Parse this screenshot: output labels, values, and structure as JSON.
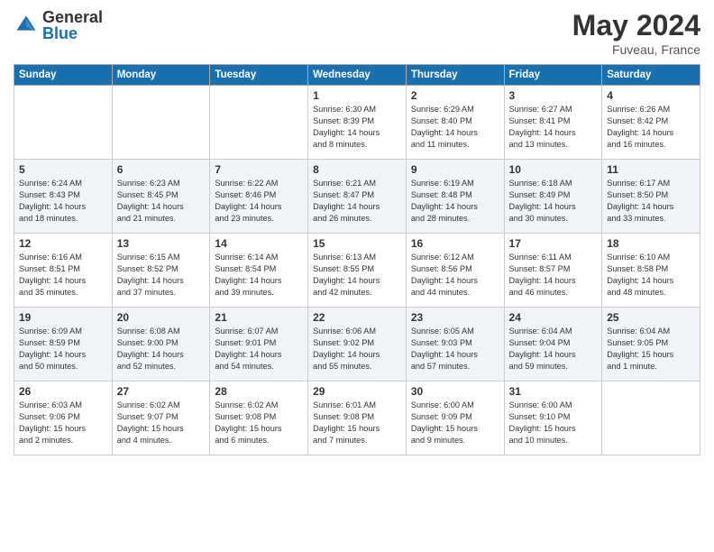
{
  "header": {
    "logo_general": "General",
    "logo_blue": "Blue",
    "month_title": "May 2024",
    "location": "Fuveau, France"
  },
  "days_of_week": [
    "Sunday",
    "Monday",
    "Tuesday",
    "Wednesday",
    "Thursday",
    "Friday",
    "Saturday"
  ],
  "weeks": [
    {
      "cells": [
        {
          "day": "",
          "content": ""
        },
        {
          "day": "",
          "content": ""
        },
        {
          "day": "",
          "content": ""
        },
        {
          "day": "1",
          "content": "Sunrise: 6:30 AM\nSunset: 8:39 PM\nDaylight: 14 hours\nand 8 minutes."
        },
        {
          "day": "2",
          "content": "Sunrise: 6:29 AM\nSunset: 8:40 PM\nDaylight: 14 hours\nand 11 minutes."
        },
        {
          "day": "3",
          "content": "Sunrise: 6:27 AM\nSunset: 8:41 PM\nDaylight: 14 hours\nand 13 minutes."
        },
        {
          "day": "4",
          "content": "Sunrise: 6:26 AM\nSunset: 8:42 PM\nDaylight: 14 hours\nand 16 minutes."
        }
      ]
    },
    {
      "cells": [
        {
          "day": "5",
          "content": "Sunrise: 6:24 AM\nSunset: 8:43 PM\nDaylight: 14 hours\nand 18 minutes."
        },
        {
          "day": "6",
          "content": "Sunrise: 6:23 AM\nSunset: 8:45 PM\nDaylight: 14 hours\nand 21 minutes."
        },
        {
          "day": "7",
          "content": "Sunrise: 6:22 AM\nSunset: 8:46 PM\nDaylight: 14 hours\nand 23 minutes."
        },
        {
          "day": "8",
          "content": "Sunrise: 6:21 AM\nSunset: 8:47 PM\nDaylight: 14 hours\nand 26 minutes."
        },
        {
          "day": "9",
          "content": "Sunrise: 6:19 AM\nSunset: 8:48 PM\nDaylight: 14 hours\nand 28 minutes."
        },
        {
          "day": "10",
          "content": "Sunrise: 6:18 AM\nSunset: 8:49 PM\nDaylight: 14 hours\nand 30 minutes."
        },
        {
          "day": "11",
          "content": "Sunrise: 6:17 AM\nSunset: 8:50 PM\nDaylight: 14 hours\nand 33 minutes."
        }
      ]
    },
    {
      "cells": [
        {
          "day": "12",
          "content": "Sunrise: 6:16 AM\nSunset: 8:51 PM\nDaylight: 14 hours\nand 35 minutes."
        },
        {
          "day": "13",
          "content": "Sunrise: 6:15 AM\nSunset: 8:52 PM\nDaylight: 14 hours\nand 37 minutes."
        },
        {
          "day": "14",
          "content": "Sunrise: 6:14 AM\nSunset: 8:54 PM\nDaylight: 14 hours\nand 39 minutes."
        },
        {
          "day": "15",
          "content": "Sunrise: 6:13 AM\nSunset: 8:55 PM\nDaylight: 14 hours\nand 42 minutes."
        },
        {
          "day": "16",
          "content": "Sunrise: 6:12 AM\nSunset: 8:56 PM\nDaylight: 14 hours\nand 44 minutes."
        },
        {
          "day": "17",
          "content": "Sunrise: 6:11 AM\nSunset: 8:57 PM\nDaylight: 14 hours\nand 46 minutes."
        },
        {
          "day": "18",
          "content": "Sunrise: 6:10 AM\nSunset: 8:58 PM\nDaylight: 14 hours\nand 48 minutes."
        }
      ]
    },
    {
      "cells": [
        {
          "day": "19",
          "content": "Sunrise: 6:09 AM\nSunset: 8:59 PM\nDaylight: 14 hours\nand 50 minutes."
        },
        {
          "day": "20",
          "content": "Sunrise: 6:08 AM\nSunset: 9:00 PM\nDaylight: 14 hours\nand 52 minutes."
        },
        {
          "day": "21",
          "content": "Sunrise: 6:07 AM\nSunset: 9:01 PM\nDaylight: 14 hours\nand 54 minutes."
        },
        {
          "day": "22",
          "content": "Sunrise: 6:06 AM\nSunset: 9:02 PM\nDaylight: 14 hours\nand 55 minutes."
        },
        {
          "day": "23",
          "content": "Sunrise: 6:05 AM\nSunset: 9:03 PM\nDaylight: 14 hours\nand 57 minutes."
        },
        {
          "day": "24",
          "content": "Sunrise: 6:04 AM\nSunset: 9:04 PM\nDaylight: 14 hours\nand 59 minutes."
        },
        {
          "day": "25",
          "content": "Sunrise: 6:04 AM\nSunset: 9:05 PM\nDaylight: 15 hours\nand 1 minute."
        }
      ]
    },
    {
      "cells": [
        {
          "day": "26",
          "content": "Sunrise: 6:03 AM\nSunset: 9:06 PM\nDaylight: 15 hours\nand 2 minutes."
        },
        {
          "day": "27",
          "content": "Sunrise: 6:02 AM\nSunset: 9:07 PM\nDaylight: 15 hours\nand 4 minutes."
        },
        {
          "day": "28",
          "content": "Sunrise: 6:02 AM\nSunset: 9:08 PM\nDaylight: 15 hours\nand 6 minutes."
        },
        {
          "day": "29",
          "content": "Sunrise: 6:01 AM\nSunset: 9:08 PM\nDaylight: 15 hours\nand 7 minutes."
        },
        {
          "day": "30",
          "content": "Sunrise: 6:00 AM\nSunset: 9:09 PM\nDaylight: 15 hours\nand 9 minutes."
        },
        {
          "day": "31",
          "content": "Sunrise: 6:00 AM\nSunset: 9:10 PM\nDaylight: 15 hours\nand 10 minutes."
        },
        {
          "day": "",
          "content": ""
        }
      ]
    }
  ]
}
